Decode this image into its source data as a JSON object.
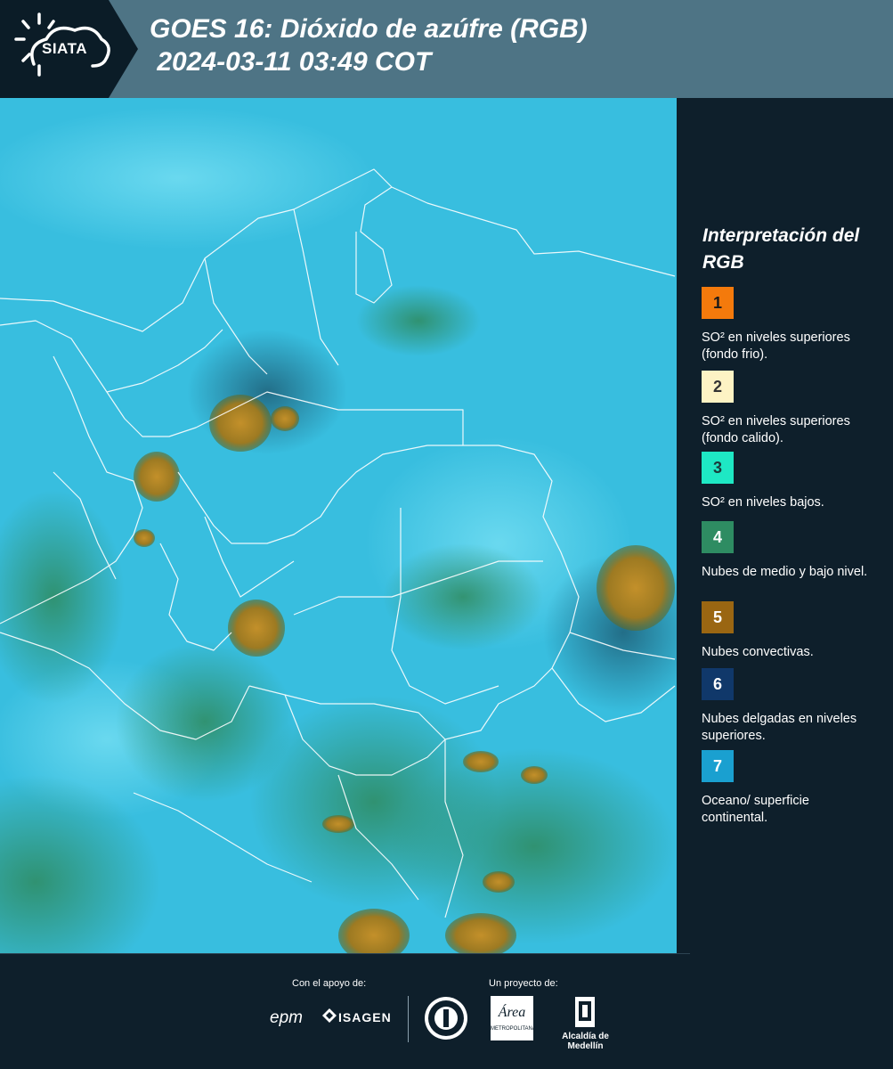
{
  "header": {
    "logo_text": "SIATA",
    "title_line1": "GOES 16: Dióxido de azúfre (RGB)",
    "title_line2": " 2024-03-11 03:49 COT"
  },
  "legend": {
    "title": "Interpretación del RGB",
    "items": [
      {
        "number": "1",
        "text": "SO² en niveles superiores (fondo frio).",
        "color": "#f47a0c",
        "num_color": "#1a1a1a"
      },
      {
        "number": "2",
        "text": "SO² en niveles superiores (fondo calido).",
        "color": "#fdf3c4",
        "num_color": "#333333"
      },
      {
        "number": "3",
        "text": "SO² en niveles bajos.",
        "color": "#1ee8c4",
        "num_color": "#1a3a3a"
      },
      {
        "number": "4",
        "text": "Nubes de medio y bajo nivel.",
        "color": "#2e8c62",
        "num_color": "#ffffff"
      },
      {
        "number": "5",
        "text": "Nubes convectivas.",
        "color": "#9a6612",
        "num_color": "#ffffff"
      },
      {
        "number": "6",
        "text": "Nubes delgadas en niveles superiores.",
        "color": "#10386a",
        "num_color": "#ffffff"
      },
      {
        "number": "7",
        "text": "Oceano/ superficie continental.",
        "color": "#1aa0d0",
        "num_color": "#ffffff"
      }
    ]
  },
  "footer": {
    "support_label": "Con el apoyo de:",
    "project_label": "Un proyecto de:",
    "sponsor_epm": "epm",
    "sponsor_isagen": "ISAGEN",
    "partner_area": "Área",
    "partner_area_sub": "METROPOLITANA",
    "partner_alcaldia": "Alcaldía de Medellín"
  },
  "colors": {
    "header_bg": "#4e7485",
    "panel_bg": "#0e1f2b",
    "map_cyan": "#3fc6e6",
    "cloud_orange": "#a37a26"
  }
}
